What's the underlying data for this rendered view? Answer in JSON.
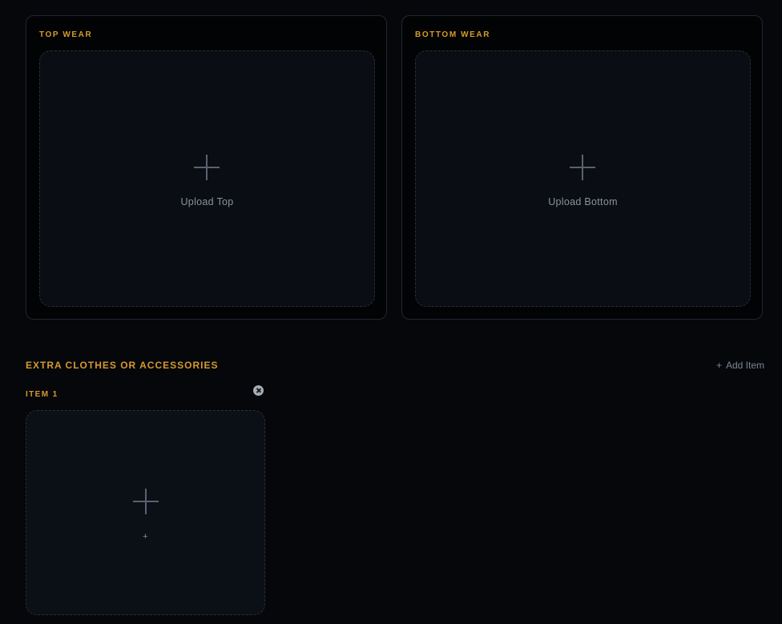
{
  "top_wear": {
    "title": "TOP WEAR",
    "upload_label": "Upload Top"
  },
  "bottom_wear": {
    "title": "BOTTOM WEAR",
    "upload_label": "Upload Bottom"
  },
  "extras": {
    "title": "EXTRA CLOTHES OR ACCESSORIES",
    "add_item_icon": "+",
    "add_item_label": "Add Item",
    "items": [
      {
        "label": "ITEM 1",
        "upload_label": "+"
      }
    ]
  },
  "colors": {
    "accent": "#d69a2d",
    "background": "#05070a",
    "panel_border": "#23262f",
    "dropzone_bg": "#0a0d13",
    "muted_text": "#8a919d"
  }
}
